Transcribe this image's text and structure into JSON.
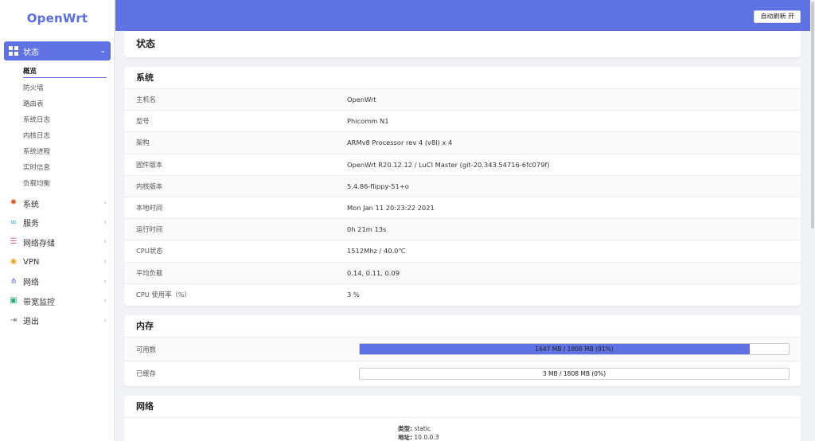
{
  "brand": "OpenWrt",
  "sidebar": {
    "active": {
      "label": "状态",
      "icon": "dashboard-icon"
    },
    "subitems": [
      "概览",
      "防火墙",
      "路由表",
      "系统日志",
      "内核日志",
      "系统进程",
      "实时信息",
      "负载均衡"
    ],
    "items": [
      {
        "label": "系统",
        "icon": "gear-icon",
        "color": "#e8542c"
      },
      {
        "label": "服务",
        "icon": "link-icon",
        "color": "#2a9de6"
      },
      {
        "label": "网络存储",
        "icon": "storage-icon",
        "color": "#e85a7a"
      },
      {
        "label": "VPN",
        "icon": "vpn-icon",
        "color": "#f0a020"
      },
      {
        "label": "网络",
        "icon": "network-icon",
        "color": "#5e72e4"
      },
      {
        "label": "带宽监控",
        "icon": "monitor-icon",
        "color": "#20b070"
      },
      {
        "label": "退出",
        "icon": "logout-icon",
        "color": "#666666"
      }
    ]
  },
  "header": {
    "refresh_label": "自动刷新 开"
  },
  "page_title": "状态",
  "system": {
    "title": "系统",
    "rows": [
      {
        "k": "主机名",
        "v": "OpenWrt"
      },
      {
        "k": "型号",
        "v": "Phicomm N1"
      },
      {
        "k": "架构",
        "v": "ARMv8 Processor rev 4 (v8l) x 4"
      },
      {
        "k": "固件版本",
        "v": "OpenWrt R20.12.12 / LuCI Master (git-20.343.54716-6fc079f)"
      },
      {
        "k": "内核版本",
        "v": "5.4.86-flippy-51+o"
      },
      {
        "k": "本地时间",
        "v": "Mon Jan 11 20:23:22 2021"
      },
      {
        "k": "运行时间",
        "v": "0h 21m 13s"
      },
      {
        "k": "CPU状态",
        "v": "1512Mhz / 40.0℃"
      },
      {
        "k": "平均负载",
        "v": "0.14, 0.11, 0.09"
      },
      {
        "k": "CPU 使用率（%）",
        "v": "3 %"
      }
    ]
  },
  "memory": {
    "title": "内存",
    "rows": [
      {
        "k": "可用数",
        "label": "1647 MB / 1808 MB (91%)",
        "percent": 91
      },
      {
        "k": "已缓存",
        "label": "3 MB / 1808 MB (0%)",
        "percent": 0
      }
    ]
  },
  "network": {
    "title": "网络",
    "type_key": "类型:",
    "type_val": "static",
    "addr_key": "地址:",
    "addr_val": "10.0.0.3"
  }
}
